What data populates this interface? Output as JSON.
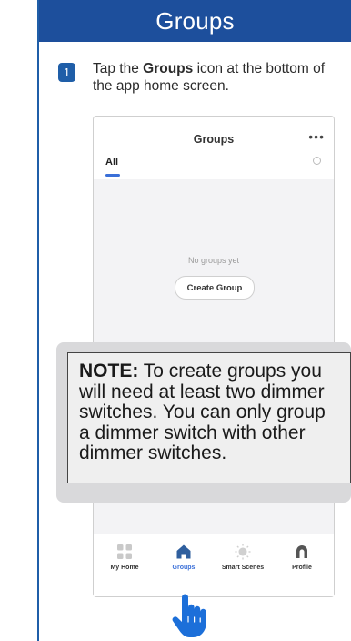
{
  "header": {
    "title": "Groups"
  },
  "step": {
    "number": "1",
    "text_before": "Tap the ",
    "text_bold": "Groups",
    "text_after": " icon at the bottom of the app home screen."
  },
  "phone": {
    "app_title": "Groups",
    "more_label": "•••",
    "tab_all": "All",
    "empty_text": "No groups yet",
    "create_button": "Create Group",
    "nav": [
      {
        "label": "My Home",
        "icon": "grid-icon",
        "active": false
      },
      {
        "label": "Groups",
        "icon": "home-icon",
        "active": true
      },
      {
        "label": "Smart Scenes",
        "icon": "sun-icon",
        "active": false
      },
      {
        "label": "Profile",
        "icon": "profile-icon",
        "active": false
      }
    ]
  },
  "note": {
    "label": "NOTE:",
    "text": " To create groups you will need at least two dimmer switches. You can only group a dimmer switch with other dimmer switches."
  },
  "colors": {
    "header_bg": "#1d4f9c",
    "accent": "#3a6fd8",
    "hand": "#1c6fd9"
  }
}
